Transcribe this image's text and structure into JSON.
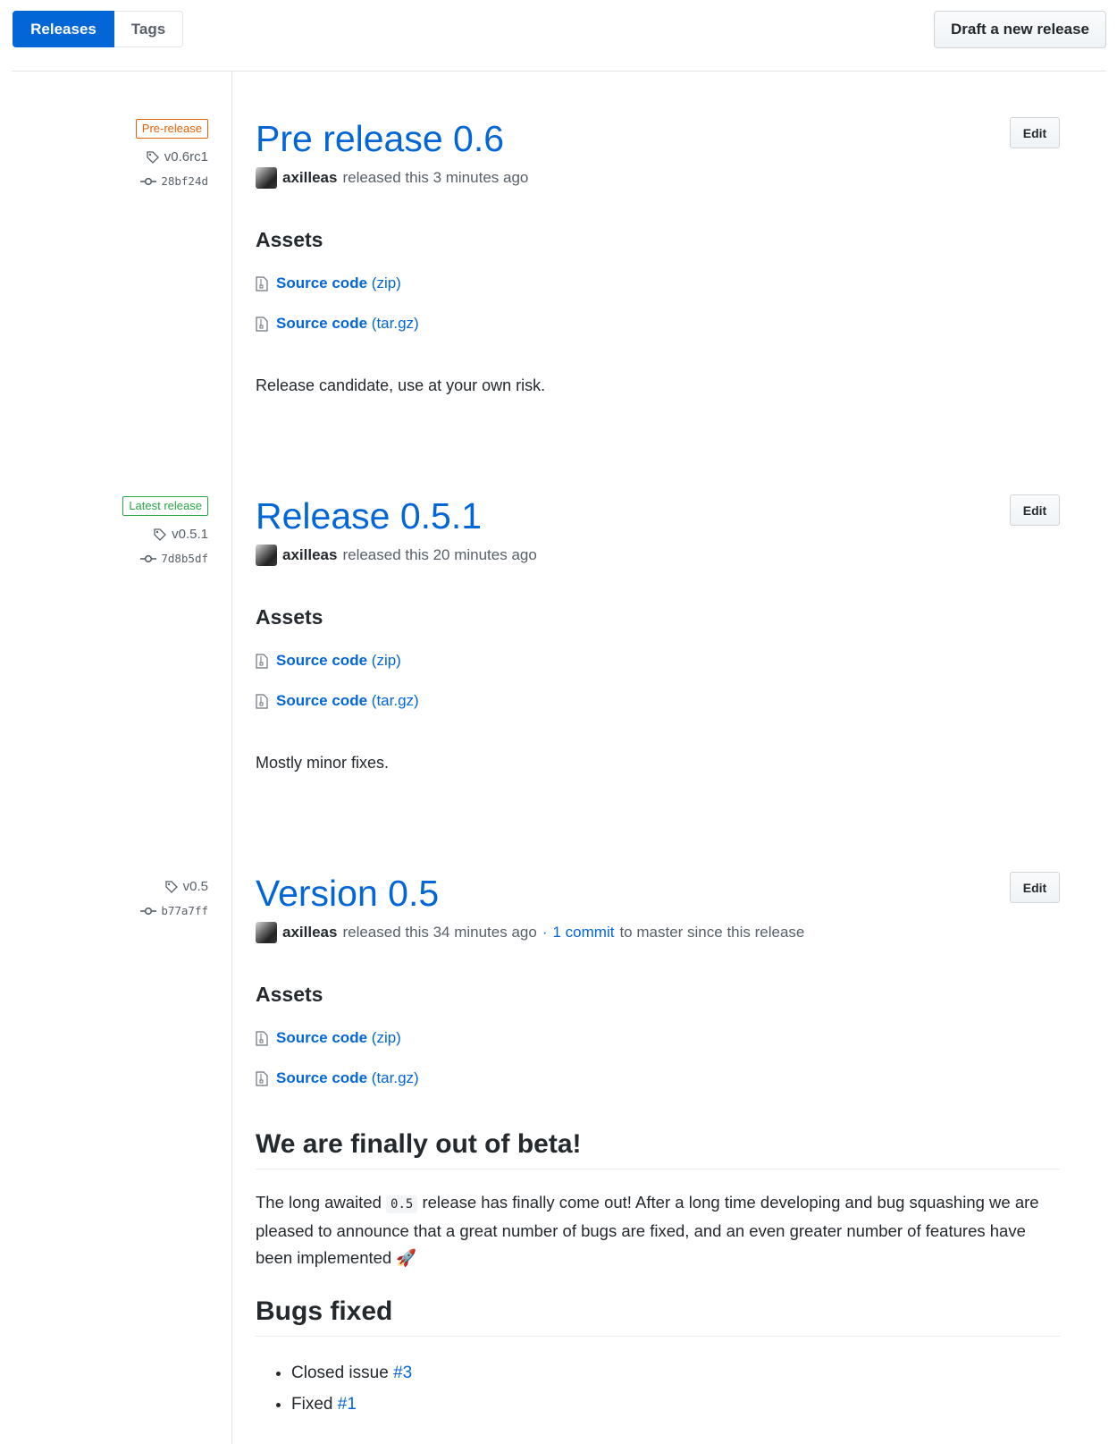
{
  "tabs": {
    "releases": "Releases",
    "tags": "Tags"
  },
  "draft_button": "Draft a new release",
  "edit_label": "Edit",
  "assets_heading": "Assets",
  "source_code_label": "Source code",
  "releases": [
    {
      "badge": "Pre-release",
      "tag": "v0.6rc1",
      "commit": "28bf24d",
      "title": "Pre release 0.6",
      "author": "axilleas",
      "released_text": "released this 3 minutes ago",
      "assets": [
        {
          "label": "Source code",
          "format": "(zip)"
        },
        {
          "label": "Source code",
          "format": "(tar.gz)"
        }
      ],
      "description": "Release candidate, use at your own risk."
    },
    {
      "badge": "Latest release",
      "tag": "v0.5.1",
      "commit": "7d8b5df",
      "title": "Release 0.5.1",
      "author": "axilleas",
      "released_text": "released this 20 minutes ago",
      "assets": [
        {
          "label": "Source code",
          "format": "(zip)"
        },
        {
          "label": "Source code",
          "format": "(tar.gz)"
        }
      ],
      "description": "Mostly minor fixes."
    },
    {
      "tag": "v0.5",
      "commit": "b77a7ff",
      "title": "Version 0.5",
      "author": "axilleas",
      "released_text": "released this 34 minutes ago",
      "separator": "·",
      "commits_link": "1 commit",
      "commits_suffix": "to master since this release",
      "assets": [
        {
          "label": "Source code",
          "format": "(zip)"
        },
        {
          "label": "Source code",
          "format": "(tar.gz)"
        }
      ],
      "notes": {
        "heading": "We are finally out of beta!",
        "para_before": "The long awaited",
        "code": "0.5",
        "para_after": "release has finally come out! After a long time developing and bug squashing we are pleased to announce that a great number of bugs are fixed, and an even greater number of features have been implemented",
        "emoji": "🚀",
        "bugs_heading": "Bugs fixed",
        "bugs": [
          {
            "text": "Closed issue",
            "link": "#3"
          },
          {
            "text": "Fixed",
            "link": "#1"
          }
        ]
      }
    }
  ]
}
